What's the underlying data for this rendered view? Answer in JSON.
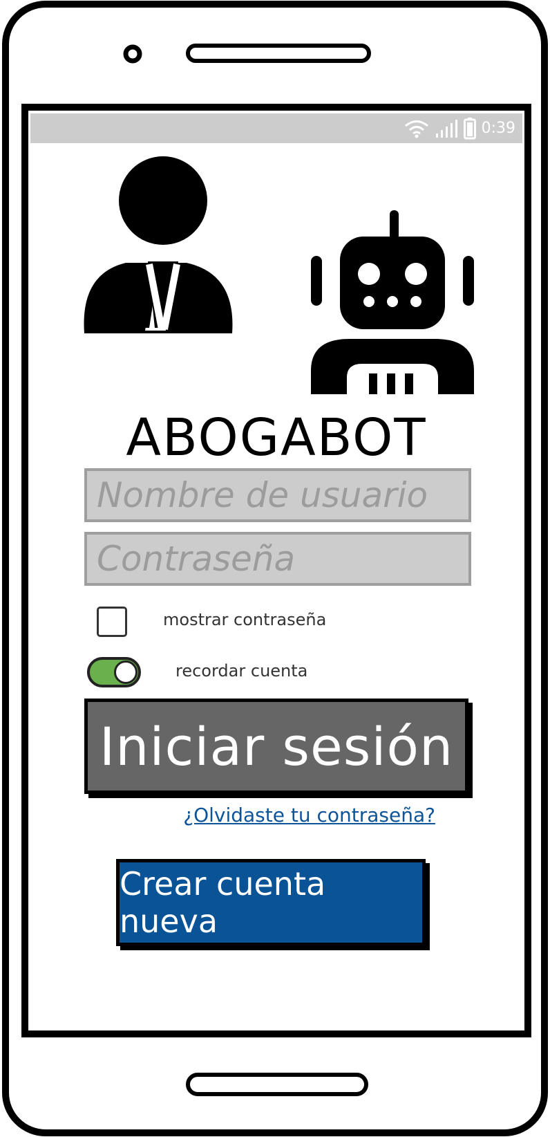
{
  "status_bar": {
    "time": "0:39",
    "icons": [
      "wifi-icon",
      "signal-icon",
      "battery-icon"
    ]
  },
  "app": {
    "title": "ABOGABOT"
  },
  "form": {
    "username_placeholder": "Nombre de usuario",
    "username_value": "",
    "password_placeholder": "Contraseña",
    "password_value": "",
    "show_password_label": "mostrar contraseña",
    "show_password_checked": false,
    "remember_label": "recordar cuenta",
    "remember_on": true,
    "login_label": "Iniciar sesión",
    "forgot_link": "¿Olvidaste tu contraseña?",
    "create_label": "Crear cuenta nueva"
  },
  "colors": {
    "statusbar": "#cccccc",
    "field_bg": "#cccccc",
    "login_button": "#666666",
    "create_button": "#0a5397",
    "link": "#0d5499",
    "toggle_on": "#6ab04c"
  }
}
